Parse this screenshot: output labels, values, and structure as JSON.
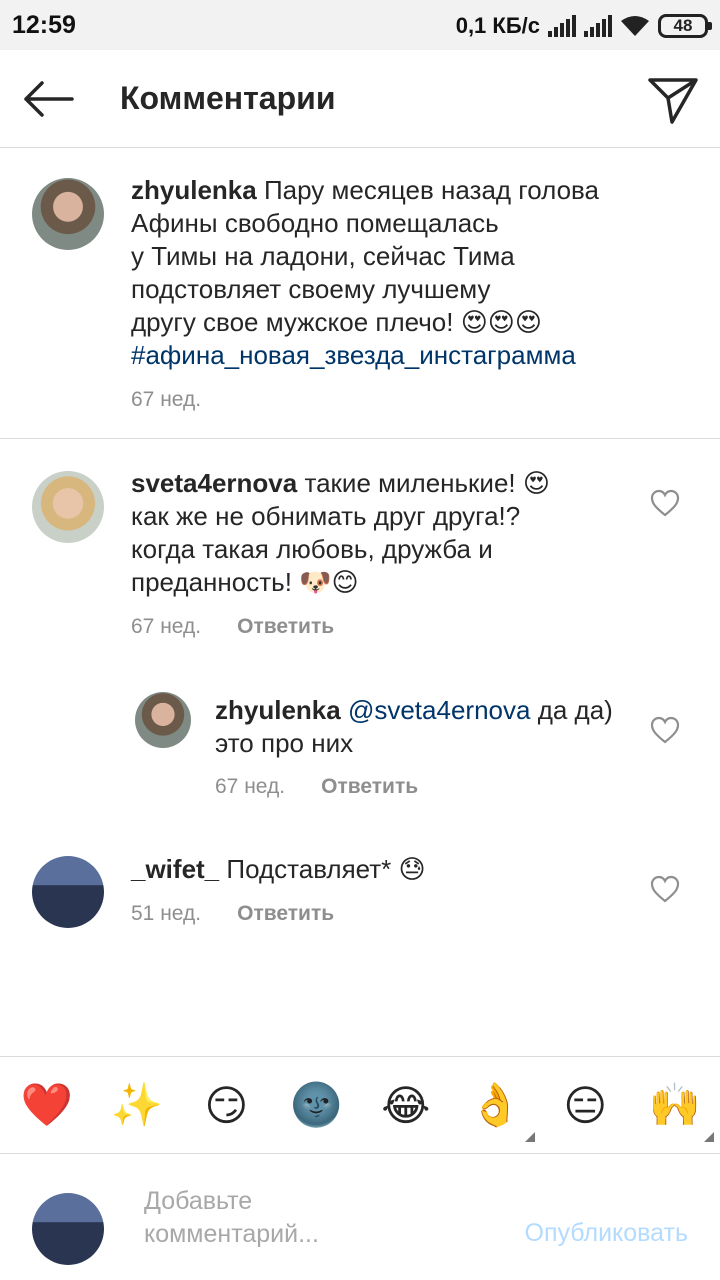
{
  "status_bar": {
    "time": "12:59",
    "network_speed": "0,1 КБ/с",
    "battery": "48"
  },
  "header": {
    "title": "Комментарии"
  },
  "caption": {
    "username": "zhyulenka",
    "line1": "Пару месяцев назад голова",
    "line2": "Афины свободно помещалась",
    "line3": "у Тимы на ладони, сейчас Тима",
    "line4": "подстовляет своему лучшему",
    "line5": "другу свое мужское плечо!",
    "emojis": "😍😍😍",
    "hashtag": "#афина_новая_звезда_инстаграмма",
    "time": "67 нед."
  },
  "comments": [
    {
      "username": "sveta4ernova",
      "line1": "такие миленькие!",
      "line1_emoji": "😍",
      "line2": "как же не обнимать друг друга!?",
      "line3": "когда такая любовь, дружба и",
      "line4": "преданность!",
      "line4_emoji": "🐶😊",
      "time": "67 нед.",
      "reply_label": "Ответить"
    },
    {
      "username": "zhyulenka",
      "mention": "@sveta4ernova",
      "line1": "да да)",
      "line2": "это про них",
      "time": "67 нед.",
      "reply_label": "Ответить"
    },
    {
      "username": "_wifet_",
      "line1": "Подставляет*",
      "line1_emoji": "😓",
      "time": "51 нед.",
      "reply_label": "Ответить"
    }
  ],
  "emoji_bar": [
    "❤️",
    "✨",
    "😏",
    "🌚",
    "😂",
    "👌",
    "😑",
    "🙌"
  ],
  "input": {
    "placeholder_line1": "Добавьте",
    "placeholder_line2": "комментарий...",
    "publish_label": "Опубликовать"
  },
  "colors": {
    "link": "#003569",
    "secondary_text": "#8e8e8e",
    "publish_disabled": "#b3dbff",
    "divider": "#dbdbdb"
  },
  "icons": [
    "back-arrow-icon",
    "direct-send-icon",
    "heart-outline-icon",
    "signal-icon",
    "wifi-icon",
    "battery-icon"
  ]
}
